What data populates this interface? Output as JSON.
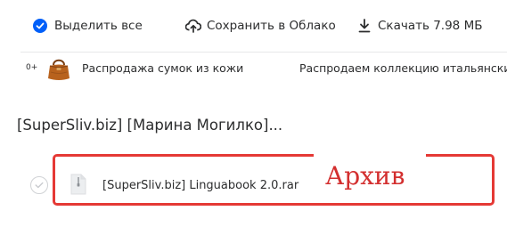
{
  "toolbar": {
    "select_all_label": "Выделить все",
    "save_to_cloud_label": "Сохранить в Облако",
    "download_label": "Скачать 7.98 МБ"
  },
  "ad": {
    "badge": "0+",
    "title": "Распродажа сумок из кожи",
    "text": "Распродаем коллекцию итальянских сумок"
  },
  "folder": {
    "title": "[SuperSliv.biz] [Марина Могилко]..."
  },
  "files": [
    {
      "name": "[SuperSliv.biz] Linguabook 2.0.rar",
      "icon": "archive-file-icon",
      "selected": false
    }
  ],
  "annotation": {
    "label": "Архив",
    "color": "#e53935"
  },
  "colors": {
    "accent": "#005ff9",
    "text": "#2c2d2e",
    "annotation_red": "#e53935"
  }
}
